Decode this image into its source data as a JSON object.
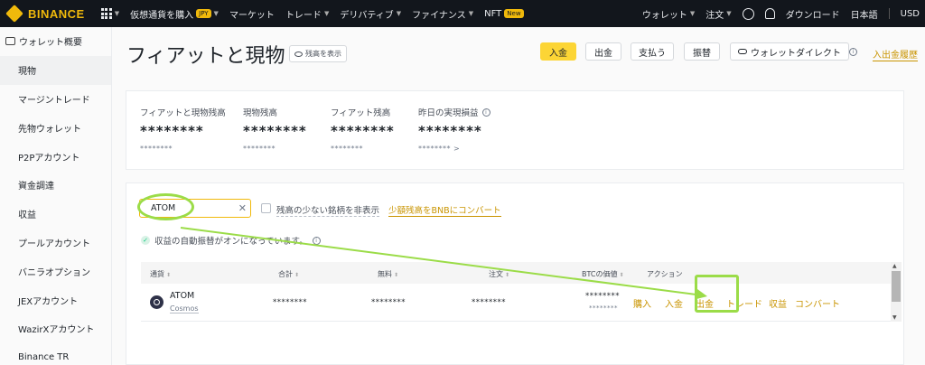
{
  "brand": "BINANCE",
  "topnav": {
    "items": [
      {
        "label": "仮想通貨を購入",
        "badge": "JPY"
      },
      {
        "label": "マーケット"
      },
      {
        "label": "トレード"
      },
      {
        "label": "デリバティブ"
      },
      {
        "label": "ファイナンス"
      },
      {
        "label": "NFT",
        "badge": "New"
      }
    ],
    "right": {
      "wallet": "ウォレット",
      "orders": "注文",
      "download": "ダウンロード",
      "language": "日本語",
      "currency": "USD"
    }
  },
  "sidebar": {
    "header": "ウォレット概要",
    "items": [
      "現物",
      "マージントレード",
      "先物ウォレット",
      "P2Pアカウント",
      "資金調達",
      "収益",
      "プールアカウント",
      "バニラオプション",
      "JEXアカウント",
      "WazirXアカウント",
      "Binance TR"
    ]
  },
  "page": {
    "title": "フィアットと現物",
    "show_balance": "残高を表示",
    "buttons": {
      "deposit": "入金",
      "withdraw": "出金",
      "pay": "支払う",
      "transfer": "振替",
      "wallet_direct": "ウォレットダイレクト",
      "history": "入出金履歴"
    }
  },
  "balances": [
    {
      "label": "フィアットと現物残高",
      "value": "********",
      "sub": "********"
    },
    {
      "label": "現物残高",
      "value": "********",
      "sub": "********"
    },
    {
      "label": "フィアット残高",
      "value": "********",
      "sub": "********"
    },
    {
      "label": "昨日の実現損益",
      "value": "********",
      "sub": "******** >"
    }
  ],
  "assets": {
    "search_value": "ATOM",
    "hide_small_label": "残高の少ない銘柄を非表示",
    "convert_link": "少額残高をBNBにコンバート",
    "auto_transfer_text": "収益の自動振替がオンになっています。",
    "headers": {
      "coin": "通貨",
      "total": "合計",
      "available": "無料",
      "locked": "注文",
      "btc_value": "BTCの価値",
      "action": "アクション"
    },
    "rows": [
      {
        "coin": "ATOM",
        "coin_full": "Cosmos",
        "total": "********",
        "available": "********",
        "locked": "********",
        "btc_value": "********",
        "btc_value_sub": "********",
        "actions": {
          "buy": "購入",
          "deposit": "入金",
          "withdraw": "出金",
          "trade": "トレード",
          "earn": "収益",
          "convert": "コンバート"
        }
      }
    ]
  },
  "colors": {
    "accent": "#f0b90b",
    "link": "#c99400",
    "highlight": "#9bdc48",
    "topbar": "#12161c"
  }
}
